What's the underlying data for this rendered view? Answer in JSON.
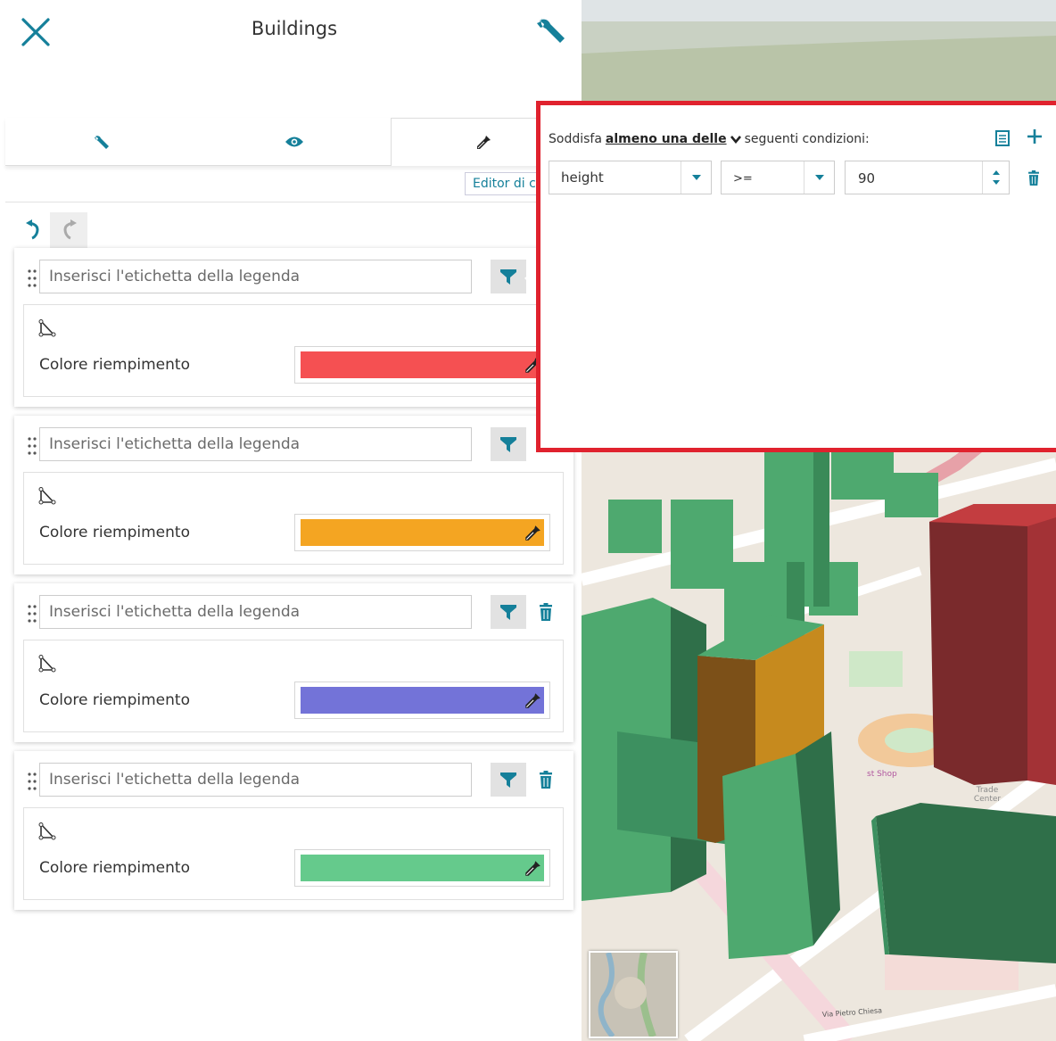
{
  "header": {
    "title": "Buildings",
    "close_icon": "close-icon",
    "settings_icon": "wrench-icon"
  },
  "tabs": [
    {
      "icon": "wrench-icon"
    },
    {
      "icon": "eye-icon"
    },
    {
      "icon": "eyedropper-icon",
      "active": true
    }
  ],
  "toolbar": {
    "editor_label": "Editor di c"
  },
  "rules": [
    {
      "placeholder": "Inserisci l'etichetta della legenda",
      "fill_label": "Colore riempimento",
      "color": "#f55052",
      "has_delete": false,
      "filter_active": true
    },
    {
      "placeholder": "Inserisci l'etichetta della legenda",
      "fill_label": "Colore riempimento",
      "color": "#f4a522",
      "has_delete": false
    },
    {
      "placeholder": "Inserisci l'etichetta della legenda",
      "fill_label": "Colore riempimento",
      "color": "#7373d8",
      "has_delete": true
    },
    {
      "placeholder": "Inserisci l'etichetta della legenda",
      "fill_label": "Colore riempimento",
      "color": "#65ca8c",
      "has_delete": true
    }
  ],
  "filter_popup": {
    "prefix": "Soddisfa",
    "mode": "almeno una delle",
    "suffix": "seguenti condizioni:",
    "condition": {
      "attribute": "height",
      "operator": ">=",
      "value": "90"
    },
    "border_color": "#e0222e"
  },
  "map": {
    "labels": {
      "trade_center": "Trade\nCenter",
      "street": "Via Pietro Chiesa",
      "shop": "st Shop"
    }
  },
  "colors": {
    "accent": "#15809a",
    "popup_border": "#e0222e"
  }
}
